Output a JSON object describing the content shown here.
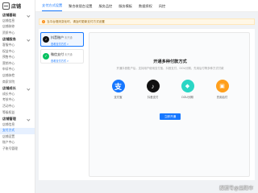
{
  "sidebar": {
    "title": "店铺",
    "items": [
      {
        "type": "group",
        "label": "店铺基础"
      },
      {
        "type": "item",
        "label": "店铺信息"
      },
      {
        "type": "item",
        "label": "店铺装修"
      },
      {
        "type": "item",
        "label": "资质中心"
      },
      {
        "type": "group",
        "label": "店铺服务"
      },
      {
        "type": "item",
        "label": "客服中心"
      },
      {
        "type": "item",
        "label": "权益中心"
      },
      {
        "type": "item",
        "label": "预售中心"
      },
      {
        "type": "item",
        "label": "营销中心"
      },
      {
        "type": "item",
        "label": "申诉中心"
      },
      {
        "type": "item",
        "label": "店铺体检"
      },
      {
        "type": "item",
        "label": "商家学院"
      },
      {
        "type": "group",
        "label": "店铺成长"
      },
      {
        "type": "item",
        "label": "成长中心"
      },
      {
        "type": "item",
        "label": "考核中心"
      },
      {
        "type": "item",
        "label": "活动中心"
      },
      {
        "type": "item",
        "label": "等级权益"
      },
      {
        "type": "group",
        "label": "店铺管理"
      },
      {
        "type": "item",
        "label": "店铺信息"
      },
      {
        "type": "item",
        "label": "支付方式",
        "active": true
      },
      {
        "type": "item",
        "label": "店铺设置"
      },
      {
        "type": "item",
        "label": "账户中心"
      },
      {
        "type": "item",
        "label": "子账号管理"
      }
    ]
  },
  "tabs": [
    {
      "label": "支付方式设置",
      "active": true
    },
    {
      "label": "聚合收银台设置"
    },
    {
      "label": "服务品控"
    },
    {
      "label": "服务模板"
    },
    {
      "label": "数据授权"
    },
    {
      "label": "风控"
    }
  ],
  "notice": {
    "icon": "warning-icon",
    "text": "当平台规则变化时，请及时更新支付方式设置"
  },
  "channels": [
    {
      "icon": "douyin-icon",
      "glyph": "♪",
      "name": "抖音账户",
      "status": "未开通",
      "link": "查看支付方式 >",
      "selected": true
    },
    {
      "icon": "wechat-icon",
      "glyph": "✓",
      "name": "微信支付",
      "status": "未开通",
      "link": "查看支付方式 >",
      "selected": false
    }
  ],
  "activate": {
    "title": "开通多种付款方式",
    "desc": "开通抖音账户后，支持用户使用支付宝、抖音支付、DOU分期、先用后付等多种方式付款",
    "methods": [
      {
        "icon": "alipay-icon",
        "glyph": "支",
        "label": "支付宝"
      },
      {
        "icon": "douyin-pay-icon",
        "glyph": "♪",
        "label": "抖音支付"
      },
      {
        "icon": "dou-installment-icon",
        "glyph": "◆",
        "label": "DOU分期"
      },
      {
        "icon": "pay-later-icon",
        "glyph": "▣",
        "label": "先用后付"
      }
    ],
    "button": "立即开通"
  },
  "watermark": "搜狐号@益阳市"
}
